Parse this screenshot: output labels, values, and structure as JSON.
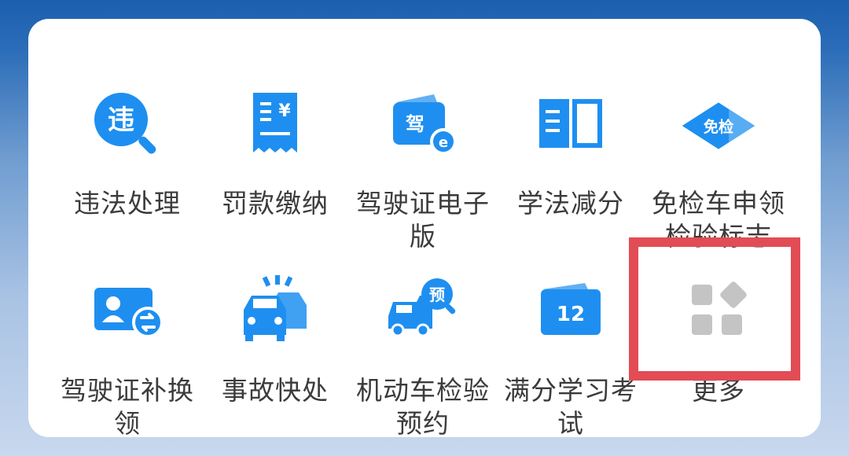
{
  "colors": {
    "accent": "#1e8ff0",
    "highlight": "#e24c55",
    "grey_icon": "#c4c4c4"
  },
  "services": [
    {
      "label": "违法处理",
      "icon": "violation-search-icon",
      "icon_text": "违"
    },
    {
      "label": "罚款缴纳",
      "icon": "fine-receipt-icon",
      "icon_text": "三¥"
    },
    {
      "label": "驾驶证电子版",
      "icon": "e-license-wallet-icon",
      "icon_text": "驾"
    },
    {
      "label": "学法减分",
      "icon": "open-book-icon",
      "icon_text": ""
    },
    {
      "label": "免检车申领检验标志",
      "icon": "exemption-diamond-icon",
      "icon_text": "免检"
    },
    {
      "label": "驾驶证补换领",
      "icon": "license-exchange-icon",
      "icon_text": ""
    },
    {
      "label": "事故快处",
      "icon": "car-accident-icon",
      "icon_text": ""
    },
    {
      "label": "机动车检验预约",
      "icon": "vehicle-inspection-booking-icon",
      "icon_text": "预"
    },
    {
      "label": "满分学习考试",
      "icon": "calendar-12-icon",
      "icon_text": "12"
    },
    {
      "label": "更多",
      "icon": "more-apps-grid-icon",
      "icon_text": ""
    }
  ]
}
